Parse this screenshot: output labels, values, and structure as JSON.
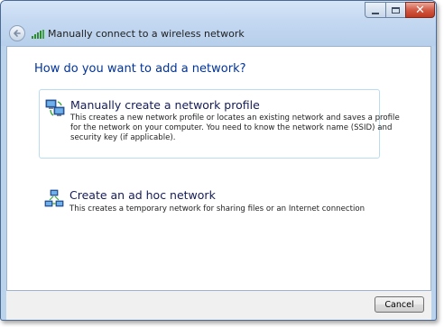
{
  "window": {
    "title": "Manually connect to a wireless network",
    "icons": {
      "title": "wireless-signal-icon",
      "back": "back-arrow-icon"
    }
  },
  "controls": {
    "close_glyph": "✕",
    "icons": [
      "minimize-icon",
      "maximize-icon",
      "close-icon"
    ]
  },
  "main": {
    "heading": "How do you want to add a network?",
    "options": [
      {
        "title": "Manually create a network profile",
        "description_lines": [
          "This creates a new network profile or locates an existing network and saves a profile",
          "for the network on your computer. You need to know the network name (SSID) and",
          "security key (if applicable)."
        ],
        "icon": "network-computers-icon"
      },
      {
        "title": "Create an ad hoc network",
        "description_lines": [
          "This creates a temporary network for sharing files or an Internet connection"
        ],
        "icon": "adhoc-network-icon"
      }
    ]
  },
  "footer": {
    "cancel_label": "Cancel"
  },
  "colors": {
    "heading": "#003399",
    "option_title": "#151c55",
    "option_border": "#b9dcf1",
    "titlebar": "#c4d8f1",
    "close_button": "#c0381f"
  }
}
